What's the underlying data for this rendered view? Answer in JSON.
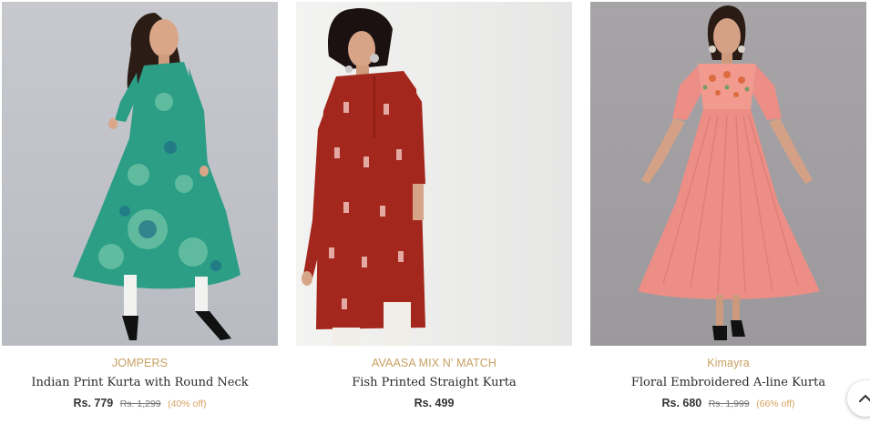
{
  "products": [
    {
      "brand": "JOMPERS",
      "title": "Indian Print Kurta with Round Neck",
      "price": "Rs. 779",
      "mrp": "Rs. 1,299",
      "discount": "(40% off)",
      "garment_color": "#2c9e86"
    },
    {
      "brand": "AVAASA MIX N' MATCH",
      "title": "Fish Printed Straight Kurta",
      "price": "Rs. 499",
      "garment_color": "#a3271c"
    },
    {
      "brand": "Kimayra",
      "title": "Floral Embroidered A-line Kurta",
      "price": "Rs. 680",
      "mrp": "Rs. 1,999",
      "discount": "(66% off)",
      "garment_color": "#ec8e86"
    }
  ],
  "scroll_top_icon": "chevron-up-icon",
  "colors": {
    "brand_text": "#c8a062",
    "discount_text": "#d5a261",
    "price_text": "#333333"
  }
}
